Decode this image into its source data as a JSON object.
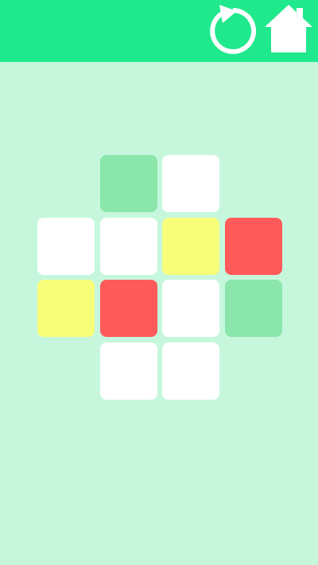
{
  "toolbar": {
    "restart_icon": "restart-icon",
    "home_icon": "home-icon",
    "bar_color": "#20e88c",
    "icon_color": "#ffffff"
  },
  "board": {
    "background": "#c6f7dd",
    "palette": {
      "green": "#8ae6ab",
      "white": "#ffffff",
      "yellow": "#f8fd79",
      "red": "#fe5a5a"
    },
    "tiles": [
      {
        "row": 0,
        "col": 1,
        "color": "green"
      },
      {
        "row": 0,
        "col": 2,
        "color": "white"
      },
      {
        "row": 1,
        "col": 0,
        "color": "white"
      },
      {
        "row": 1,
        "col": 1,
        "color": "white"
      },
      {
        "row": 1,
        "col": 2,
        "color": "yellow"
      },
      {
        "row": 1,
        "col": 3,
        "color": "red"
      },
      {
        "row": 2,
        "col": 0,
        "color": "yellow"
      },
      {
        "row": 2,
        "col": 1,
        "color": "red"
      },
      {
        "row": 2,
        "col": 2,
        "color": "white"
      },
      {
        "row": 2,
        "col": 3,
        "color": "green"
      },
      {
        "row": 3,
        "col": 1,
        "color": "white"
      },
      {
        "row": 3,
        "col": 2,
        "color": "white"
      }
    ]
  }
}
